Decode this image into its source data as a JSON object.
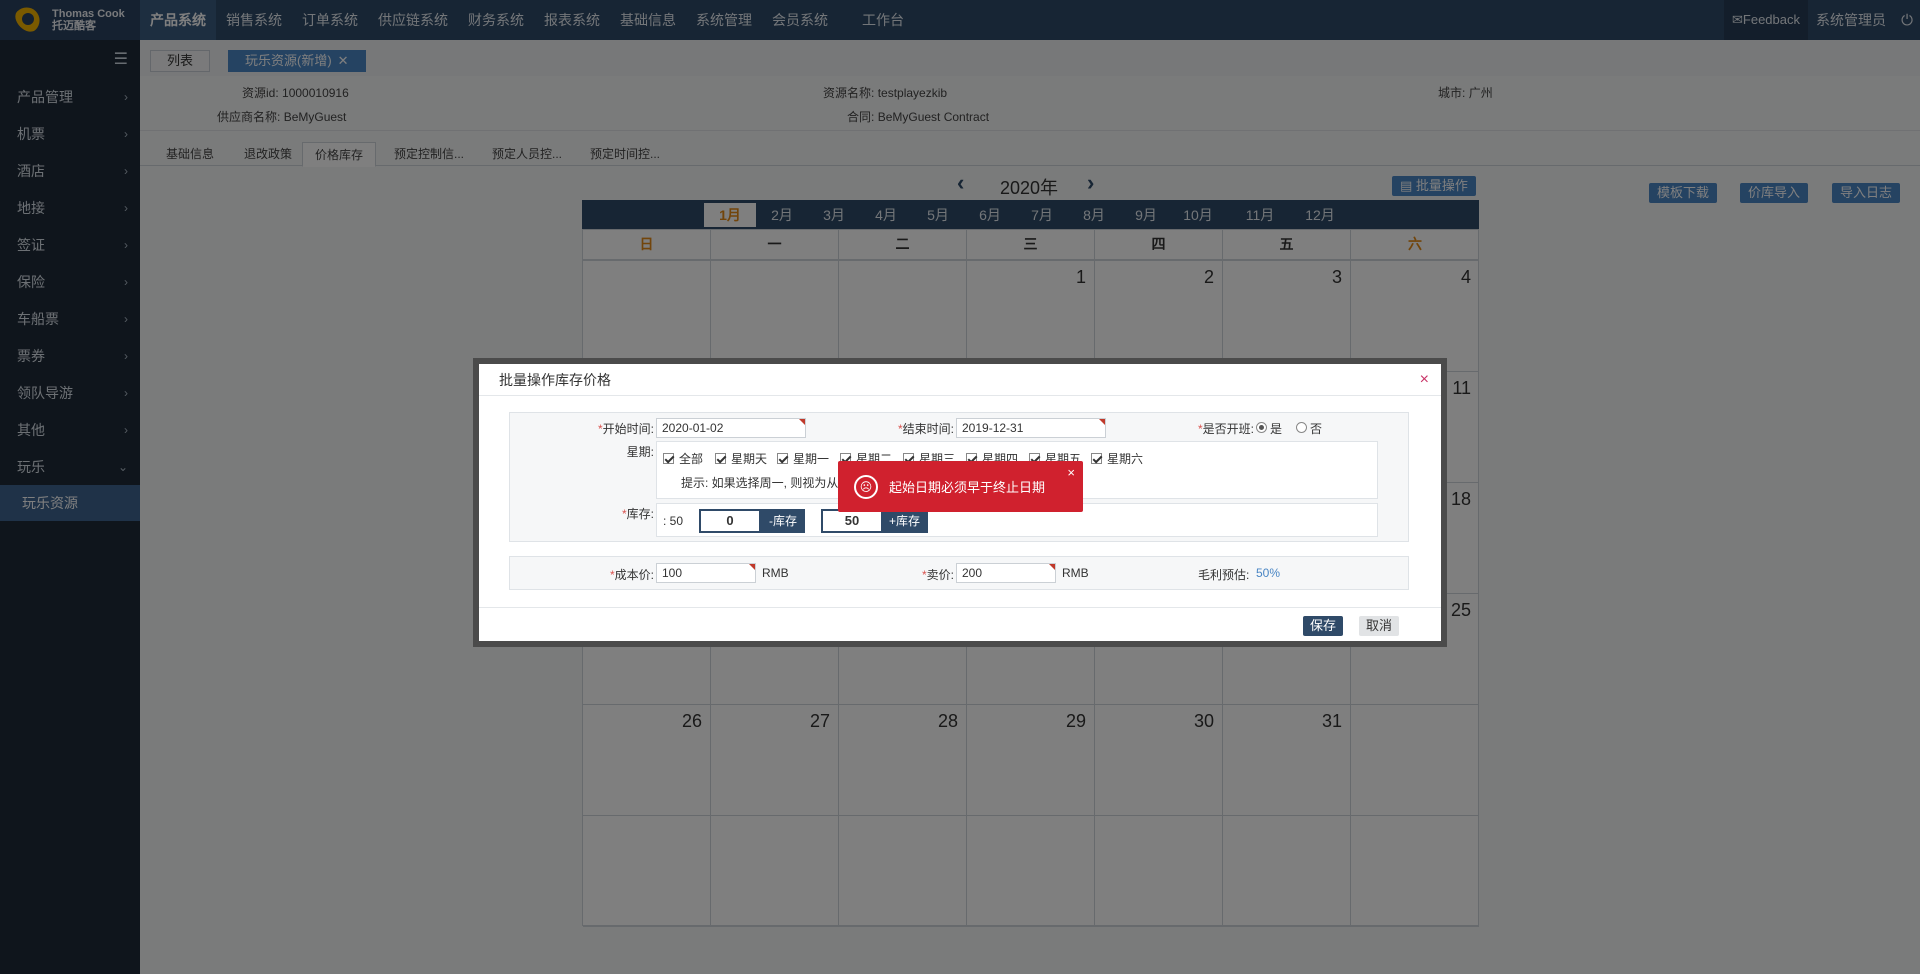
{
  "app": {
    "logo_line1": "Thomas Cook",
    "logo_line2": "托迈酷客"
  },
  "topnav": [
    "产品系统",
    "销售系统",
    "订单系统",
    "供应链系统",
    "财务系统",
    "报表系统",
    "基础信息",
    "系统管理",
    "会员系统",
    "工作台"
  ],
  "topright": {
    "feedback": "Feedback",
    "admin": "系统管理员"
  },
  "sidebar": {
    "items": [
      "产品管理",
      "机票",
      "酒店",
      "地接",
      "签证",
      "保险",
      "车船票",
      "票券",
      "领队导游",
      "其他",
      "玩乐"
    ],
    "sub_item": "玩乐资源"
  },
  "page_tabs": {
    "list": "列表",
    "active": "玩乐资源(新增)"
  },
  "info": {
    "resource_id_label": "资源id:",
    "resource_id": "1000010916",
    "resource_name_label": "资源名称:",
    "resource_name": "testplayezkib",
    "city_label": "城市:",
    "city": "广州",
    "supplier_label": "供应商名称:",
    "supplier": "BeMyGuest",
    "contract_label": "合同:",
    "contract": "BeMyGuest Contract"
  },
  "subtabs": [
    "基础信息",
    "退改政策",
    "价格库存",
    "预定控制信...",
    "预定人员控...",
    "预定时间控..."
  ],
  "calendar": {
    "year": "2020年",
    "batch_button": "批量操作",
    "right_buttons": [
      "模板下载",
      "价库导入",
      "导入日志"
    ],
    "months": [
      "1月",
      "2月",
      "3月",
      "4月",
      "5月",
      "6月",
      "7月",
      "8月",
      "9月",
      "10月",
      "11月",
      "12月"
    ],
    "weekdays": [
      "日",
      "一",
      "二",
      "三",
      "四",
      "五",
      "六"
    ],
    "row1": [
      "",
      "",
      "",
      "1",
      "2",
      "3",
      "4"
    ],
    "row2": [
      "",
      "",
      "",
      "",
      "",
      "",
      "11"
    ],
    "row3": [
      "",
      "",
      "",
      "",
      "",
      "",
      "18"
    ],
    "row4": [
      "",
      "",
      "",
      "",
      "",
      "",
      "25"
    ],
    "row5": [
      "26",
      "27",
      "28",
      "29",
      "30",
      "31",
      ""
    ],
    "row6": [
      "",
      "",
      "",
      "",
      "",
      "",
      ""
    ]
  },
  "dialog": {
    "title": "批量操作库存价格",
    "start_label": "开始时间:",
    "start_value": "2020-01-02",
    "end_label": "结束时间:",
    "end_value": "2019-12-31",
    "open_label": "是否开班:",
    "open_yes": "是",
    "open_no": "否",
    "week_label": "星期:",
    "week_options": [
      "全部",
      "星期天",
      "星期一",
      "星期二",
      "星期三",
      "星期四",
      "星期五",
      "星期六"
    ],
    "hint": "提示: 如果选择周一, 则视为从",
    "stock_label": "库存:",
    "stock_current": ": 50",
    "stock_minus_value": "0",
    "stock_minus_btn": "-库存",
    "stock_plus_value": "50",
    "stock_plus_btn": "+库存",
    "cost_label": "成本价:",
    "cost_value": "100",
    "cost_unit": "RMB",
    "sell_label": "卖价:",
    "sell_value": "200",
    "sell_unit": "RMB",
    "margin_label": "毛利预估:",
    "margin_value": "50%",
    "save": "保存",
    "cancel": "取消"
  },
  "toast": {
    "message": "起始日期必须早于终止日期",
    "close": "×"
  },
  "colors": {
    "topbar": "#2f4a68",
    "sidebar": "#1f2b39",
    "accent": "#4a86c4",
    "weekend": "#e48a17",
    "error": "#d0212e"
  }
}
